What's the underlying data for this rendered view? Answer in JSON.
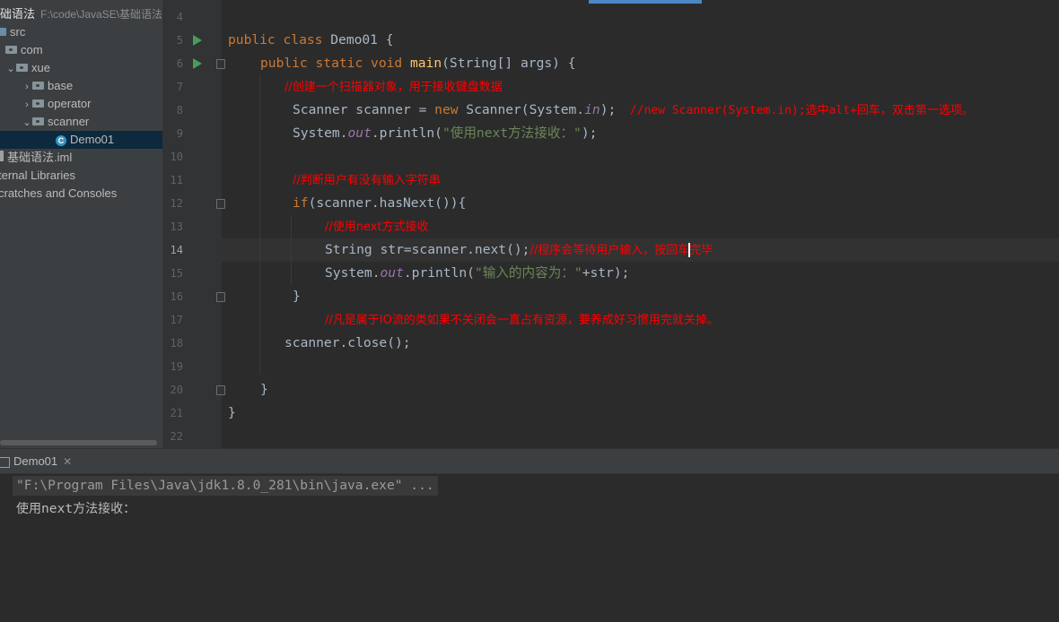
{
  "project": {
    "root_name": "础语法",
    "root_path": "F:\\code\\JavaSE\\基础语法",
    "tree": [
      {
        "label": "src",
        "kind": "src-folder"
      },
      {
        "label": "com",
        "kind": "package"
      },
      {
        "label": "xue",
        "kind": "package",
        "expanded": true
      },
      {
        "label": "base",
        "kind": "package",
        "expanded": false
      },
      {
        "label": "operator",
        "kind": "package",
        "expanded": false
      },
      {
        "label": "scanner",
        "kind": "package",
        "expanded": true
      },
      {
        "label": "Demo01",
        "kind": "class",
        "selected": true
      },
      {
        "label": "基础语法.iml",
        "kind": "file"
      },
      {
        "label": "ternal Libraries",
        "kind": "libraries"
      },
      {
        "label": "cratches and Consoles",
        "kind": "scratches"
      }
    ]
  },
  "editor": {
    "line_numbers": [
      "4",
      "5",
      "6",
      "7",
      "8",
      "9",
      "10",
      "11",
      "12",
      "13",
      "14",
      "15",
      "16",
      "17",
      "18",
      "19",
      "20",
      "21",
      "22"
    ],
    "current_line": "14",
    "lines": {
      "l5": {
        "kw1": "public",
        "kw2": "class",
        "name": "Demo01",
        "brace": "{"
      },
      "l6": {
        "kw1": "public",
        "kw2": "static",
        "kw3": "void",
        "method": "main",
        "params": "(String[] args) {"
      },
      "l7": {
        "comment": "//创建一个扫描器对象，用于接收键盘数据"
      },
      "l8": {
        "decl": "Scanner scanner = ",
        "kw": "new",
        "call": " Scanner(System.",
        "field": "in",
        "end": ");",
        "comment": "  //new Scanner(System.in);选中alt+回车，双击第一选项。"
      },
      "l9": {
        "pre": "System.",
        "field": "out",
        "call": ".println(",
        "string": "\"使用next方法接收：\"",
        "end": ");"
      },
      "l11": {
        "comment": "//判断用户有没有输入字符串"
      },
      "l12": {
        "kw": "if",
        "rest": "(scanner.hasNext()){"
      },
      "l13": {
        "comment": "//使用next方式接收"
      },
      "l14": {
        "code": "String str=scanner.next();",
        "comment_a": "//程序会等待用户输入，按回车",
        "comment_b": "完毕"
      },
      "l15": {
        "pre": "System.",
        "field": "out",
        "call": ".println(",
        "string": "\"输入的内容为：\"",
        "end": "+str);"
      },
      "l16": {
        "brace": "}"
      },
      "l17": {
        "comment": "//凡是属于IO流的类如果不关闭会一直占有资源，要养成好习惯用完就关掉。"
      },
      "l18": {
        "code": "scanner.close();"
      },
      "l20": {
        "brace": "}"
      },
      "l21": {
        "brace": "}"
      }
    }
  },
  "run": {
    "tab_label": "Demo01",
    "command": "\"F:\\Program Files\\Java\\jdk1.8.0_281\\bin\\java.exe\" ...",
    "output_prefix": "使用",
    "output_word": "next",
    "output_suffix": "方法接收："
  },
  "colors": {
    "keyword": "#cc7832",
    "method": "#ffc66d",
    "string": "#6a8759",
    "comment": "#ff0000",
    "field": "#9876aa",
    "run_arrow": "#499c54"
  }
}
